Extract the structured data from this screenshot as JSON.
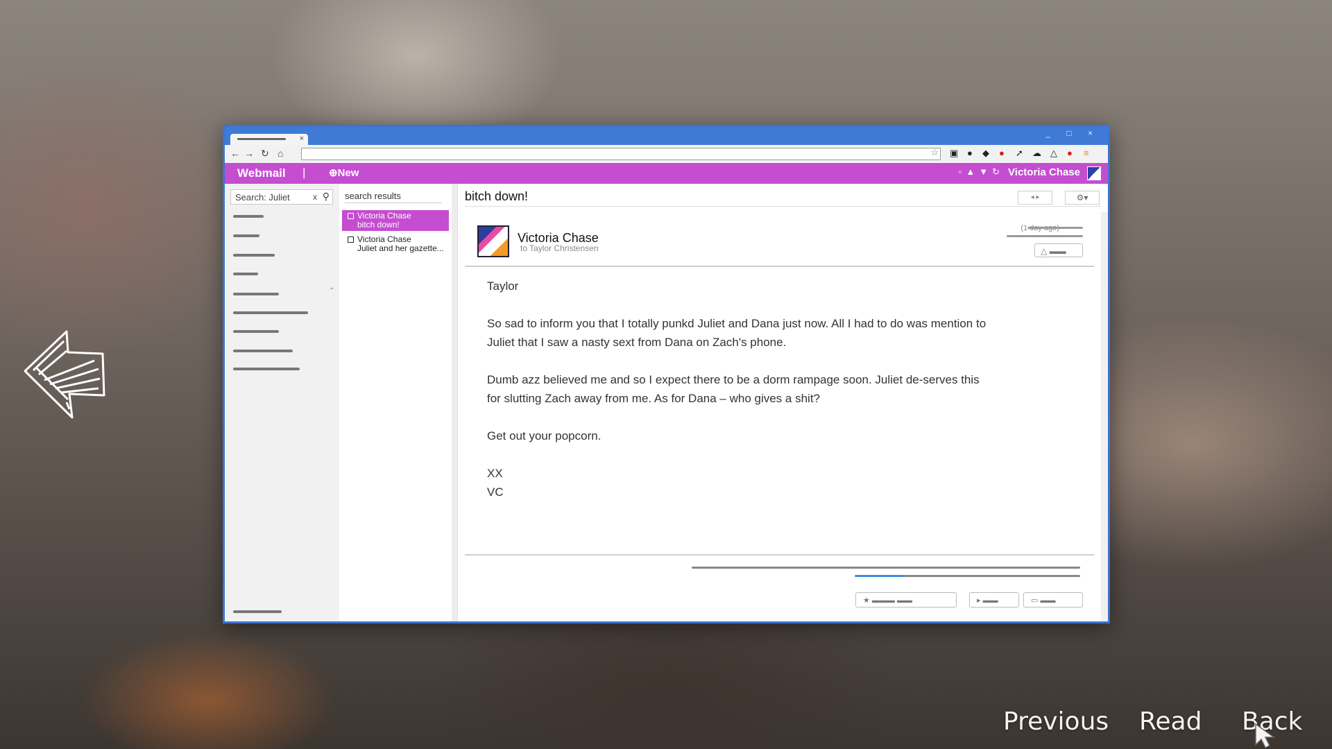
{
  "browser": {
    "window_controls": "_ □ ×"
  },
  "app": {
    "name": "Webmail",
    "separator": "|",
    "new_label": "⊕New",
    "user_name": "Victoria Chase"
  },
  "sidebar": {
    "search_value": "Search: Juliet",
    "clear_label": "x"
  },
  "list": {
    "header": "search results",
    "items": [
      {
        "from": "Victoria Chase",
        "subject": "bitch down!",
        "selected": true
      },
      {
        "from": "Victoria Chase",
        "subject": "Juliet and her gazette...",
        "selected": false
      }
    ]
  },
  "email": {
    "subject": "bitch down!",
    "sender": "Victoria Chase",
    "recipient": "to Taylor Christensen",
    "age": "(1 day ago)",
    "greeting": "Taylor",
    "paragraphs": [
      "So sad to inform you that I totally punkd Juliet and Dana just now. All I had to do was mention to Juliet that I saw a nasty sext from Dana on Zach's phone.",
      "Dumb azz believed me and so I expect there to be a dorm rampage soon. Juliet de-serves this for slutting Zach away from me. As for Dana – who gives a shit?",
      "Get out your popcorn."
    ],
    "sign_line1": "XX",
    "sign_line2": "VC"
  },
  "game_nav": {
    "previous": "Previous",
    "read": "Read",
    "back": "Back"
  },
  "colors": {
    "accent": "#c44dd0",
    "chrome": "#3f7ad6"
  }
}
